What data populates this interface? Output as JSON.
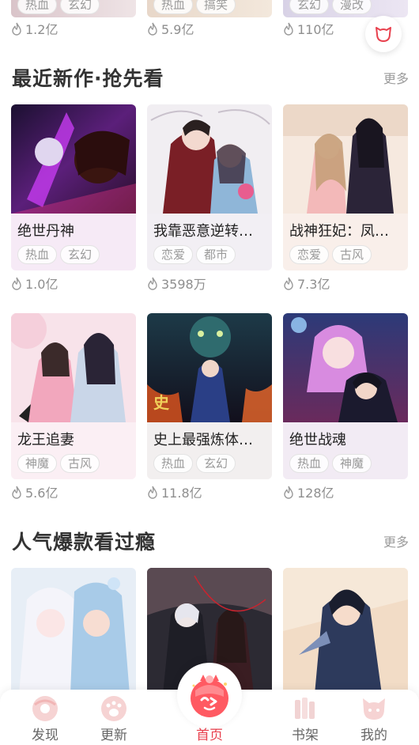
{
  "colors": {
    "accent": "#e8414e",
    "muted": "#9a9a9a",
    "title": "#333333"
  },
  "top_row": [
    {
      "tags": [
        "热血",
        "玄幻"
      ],
      "views": "1.2亿"
    },
    {
      "tags": [
        "热血",
        "搞笑"
      ],
      "views": "5.9亿"
    },
    {
      "tags": [
        "玄幻",
        "漫改"
      ],
      "views": "110亿"
    }
  ],
  "float_button": {
    "icon": "cat-head-outline-icon"
  },
  "section_new": {
    "title": "最近新作·抢先看",
    "more": "更多",
    "items": [
      {
        "title": "绝世丹神",
        "tags": [
          "热血",
          "玄幻"
        ],
        "views": "1.0亿"
      },
      {
        "title": "我靠恶意逆转…",
        "tags": [
          "恋爱",
          "都市"
        ],
        "views": "3598万"
      },
      {
        "title": "战神狂妃：凤…",
        "tags": [
          "恋爱",
          "古风"
        ],
        "views": "7.3亿"
      },
      {
        "title": "龙王追妻",
        "tags": [
          "神魔",
          "古风"
        ],
        "views": "5.6亿"
      },
      {
        "title": "史上最强炼体…",
        "tags": [
          "热血",
          "玄幻"
        ],
        "views": "11.8亿"
      },
      {
        "title": "绝世战魂",
        "tags": [
          "热血",
          "神魔"
        ],
        "views": "128亿"
      }
    ]
  },
  "section_hot": {
    "title": "人气爆款看过瘾",
    "more": "更多"
  },
  "bottom_nav": {
    "items": [
      {
        "label": "发现",
        "icon": "donut-discover-icon"
      },
      {
        "label": "更新",
        "icon": "paw-update-icon"
      },
      {
        "label": "首页",
        "icon": "home-mascot-icon"
      },
      {
        "label": "书架",
        "icon": "bookshelf-icon"
      },
      {
        "label": "我的",
        "icon": "cat-profile-icon"
      }
    ]
  }
}
